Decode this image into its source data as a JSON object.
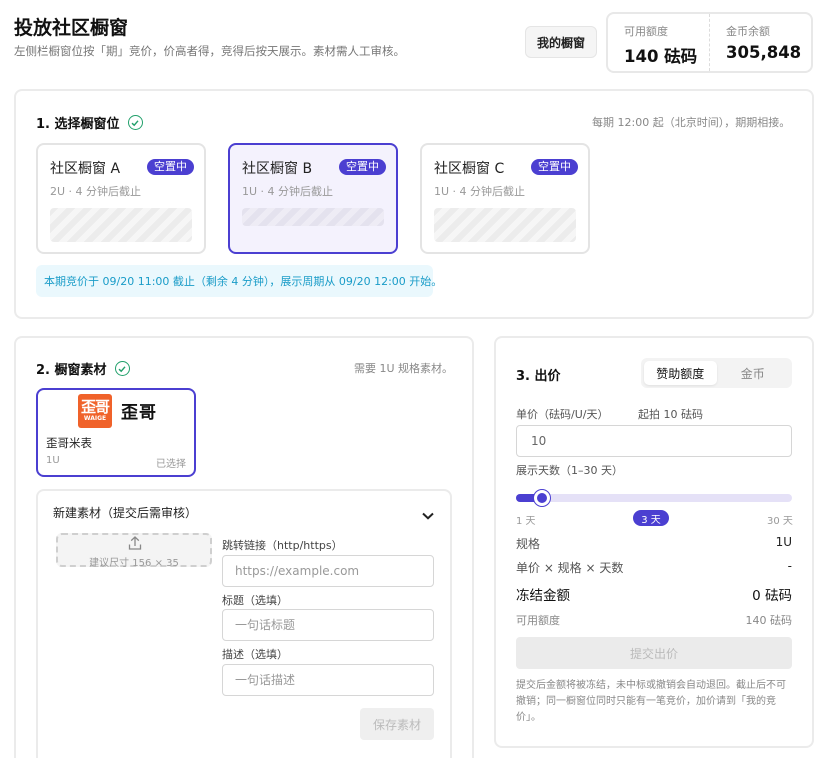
{
  "header": {
    "title": "投放社区橱窗",
    "subtitle": "左侧栏橱窗位按「期」竞价，价高者得，竞得后按天展示。素材需人工审核。",
    "my_window_button": "我的橱窗",
    "balances": [
      {
        "label": "可用额度",
        "value": "140 砝码"
      },
      {
        "label": "金币余额",
        "value": "305,848"
      }
    ]
  },
  "section1": {
    "title": "1. 选择橱窗位",
    "hint": "每期 12:00 起（北京时间），期期相接。",
    "slots": [
      {
        "name": "社区橱窗 A",
        "badge": "空置中",
        "meta": "2U · 4 分钟后截止",
        "selected": false
      },
      {
        "name": "社区橱窗 B",
        "badge": "空置中",
        "meta": "1U · 4 分钟后截止",
        "selected": true
      },
      {
        "name": "社区橱窗 C",
        "badge": "空置中",
        "meta": "1U · 4 分钟后截止",
        "selected": false
      }
    ],
    "notice": "本期竞价于 09/20 11:00 截止（剩余 4 分钟），展示周期从 09/20 12:00 开始。"
  },
  "section2": {
    "title": "2. 橱窗素材",
    "hint": "需要 1U 规格素材。",
    "material": {
      "logo_char": "歪哥",
      "logo_en": "WAIGE",
      "logo_word": "歪哥",
      "name": "歪哥米表",
      "size": "1U",
      "state": "已选择"
    },
    "new_material": {
      "title": "新建素材（提交后需审核）",
      "upload_hint": "建议尺寸 156 × 35",
      "link_label": "跳转链接（http/https）",
      "link_placeholder": "https://example.com",
      "title_label": "标题（选填）",
      "title_placeholder": "一句话标题",
      "desc_label": "描述（选填）",
      "desc_placeholder": "一句话描述",
      "save_button": "保存素材"
    }
  },
  "section3": {
    "title": "3. 出价",
    "tabs": [
      {
        "label": "赞助额度",
        "active": true
      },
      {
        "label": "金币",
        "active": false
      }
    ],
    "unit_price_label": "单价（砝码/U/天）",
    "min_bid_hint": "起拍 10 砝码",
    "unit_price_value": "10",
    "days_label": "展示天数（1–30 天）",
    "days": {
      "min": 1,
      "max": 30,
      "value": 3,
      "min_label": "1 天",
      "max_label": "30 天",
      "value_label": "3 天"
    },
    "rows": [
      {
        "label": "规格",
        "value": "1U"
      },
      {
        "label": "单价 × 规格 × 天数",
        "value": "-"
      }
    ],
    "frozen_label": "冻结金额",
    "frozen_value": "0 砝码",
    "available_label": "可用额度",
    "available_value": "140 砝码",
    "submit_button": "提交出价",
    "foot_note": "提交后金额将被冻结，未中标或撤销会自动退回。截止后不可撤销；同一橱窗位同时只能有一笔竞价，加价请到「我的竞价」。"
  },
  "colors": {
    "accent": "#4b3fd1",
    "success": "#22a06b",
    "notice_bg": "#eaf8fd",
    "notice_text": "#1a9cc8",
    "logo": "#f0622a"
  }
}
